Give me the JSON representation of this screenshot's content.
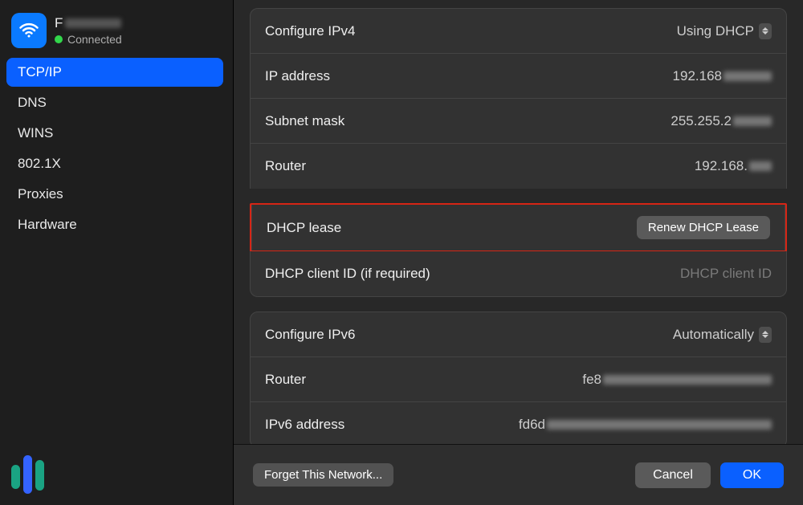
{
  "network": {
    "name_prefix": "F",
    "status": "Connected"
  },
  "sidebar": {
    "items": [
      {
        "label": "TCP/IP",
        "selected": true
      },
      {
        "label": "DNS"
      },
      {
        "label": "WINS"
      },
      {
        "label": "802.1X"
      },
      {
        "label": "Proxies"
      },
      {
        "label": "Hardware"
      }
    ]
  },
  "ipv4": {
    "configure_label": "Configure IPv4",
    "configure_value": "Using DHCP",
    "ip_label": "IP address",
    "ip_value": "192.168",
    "subnet_label": "Subnet mask",
    "subnet_value": "255.255.2",
    "router_label": "Router",
    "router_value": "192.168."
  },
  "dhcp": {
    "lease_label": "DHCP lease",
    "renew_button": "Renew DHCP Lease",
    "client_id_label": "DHCP client ID (if required)",
    "client_id_placeholder": "DHCP client ID"
  },
  "ipv6": {
    "configure_label": "Configure IPv6",
    "configure_value": "Automatically",
    "router_label": "Router",
    "router_value": "fe8",
    "address_label": "IPv6 address",
    "address_value": "fd6d"
  },
  "footer": {
    "forget": "Forget This Network...",
    "cancel": "Cancel",
    "ok": "OK"
  }
}
